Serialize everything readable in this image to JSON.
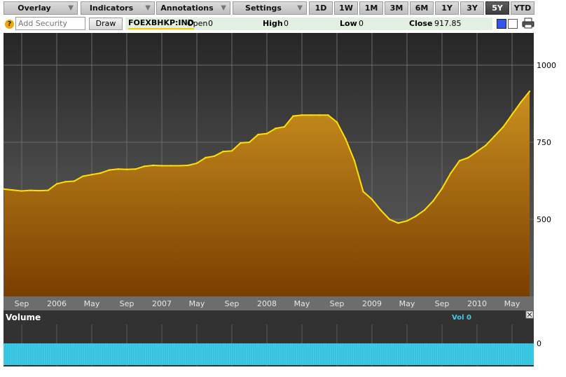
{
  "toolbar": {
    "menus": [
      {
        "label": "Overlay"
      },
      {
        "label": "Indicators"
      },
      {
        "label": "Annotations"
      },
      {
        "label": "Settings"
      }
    ],
    "ranges": [
      "1D",
      "1W",
      "1M",
      "3M",
      "6M",
      "1Y",
      "3Y",
      "5Y",
      "YTD"
    ],
    "active_range": "5Y"
  },
  "search": {
    "placeholder": "Add Security",
    "draw_label": "Draw"
  },
  "quote": {
    "ticker": "FOEXBHKP:IND",
    "open_label": "Open",
    "open_value": "0",
    "high_label": "High",
    "high_value": "0",
    "low_label": "Low",
    "low_value": "0",
    "close_label": "Close",
    "close_value": "917.85"
  },
  "icons": {
    "help": "help-icon",
    "print": "print-icon",
    "close": "close-icon"
  },
  "colors": {
    "line": "#ffe100",
    "fill_top": "#c9901f",
    "fill_bottom": "#7a3e00",
    "volume": "#3ecde8",
    "active_tab": "#4a4a4a"
  },
  "volume": {
    "title": "Volume",
    "legend": "Vol 0",
    "axis_label": "0"
  },
  "chart_data": {
    "type": "area",
    "ylim": [
      250,
      1000
    ],
    "yticks": [
      500,
      750,
      1000
    ],
    "xticks": [
      "Sep",
      "2006",
      "May",
      "Sep",
      "2007",
      "May",
      "Sep",
      "2008",
      "May",
      "Sep",
      "2009",
      "May",
      "Sep",
      "2010",
      "May"
    ],
    "x": [
      "2005-07",
      "2005-08",
      "2005-09",
      "2005-10",
      "2005-11",
      "2005-12",
      "2006-01",
      "2006-02",
      "2006-03",
      "2006-04",
      "2006-05",
      "2006-06",
      "2006-07",
      "2006-08",
      "2006-09",
      "2006-10",
      "2006-11",
      "2006-12",
      "2007-01",
      "2007-02",
      "2007-03",
      "2007-04",
      "2007-05",
      "2007-06",
      "2007-07",
      "2007-08",
      "2007-09",
      "2007-10",
      "2007-11",
      "2007-12",
      "2008-01",
      "2008-02",
      "2008-03",
      "2008-04",
      "2008-05",
      "2008-06",
      "2008-07",
      "2008-08",
      "2008-09",
      "2008-10",
      "2008-11",
      "2008-12",
      "2009-01",
      "2009-02",
      "2009-03",
      "2009-04",
      "2009-05",
      "2009-06",
      "2009-07",
      "2009-08",
      "2009-09",
      "2009-10",
      "2009-11",
      "2009-12",
      "2010-01",
      "2010-02",
      "2010-03",
      "2010-04",
      "2010-05",
      "2010-06",
      "2010-07"
    ],
    "values": [
      598,
      595,
      592,
      594,
      593,
      594,
      615,
      622,
      624,
      640,
      645,
      650,
      660,
      663,
      662,
      663,
      672,
      675,
      674,
      674,
      674,
      675,
      682,
      700,
      705,
      720,
      722,
      748,
      750,
      775,
      778,
      795,
      800,
      835,
      838,
      838,
      838,
      838,
      815,
      760,
      690,
      590,
      565,
      530,
      500,
      488,
      495,
      510,
      530,
      560,
      600,
      650,
      690,
      700,
      720,
      740,
      770,
      800,
      840,
      880,
      915
    ]
  }
}
